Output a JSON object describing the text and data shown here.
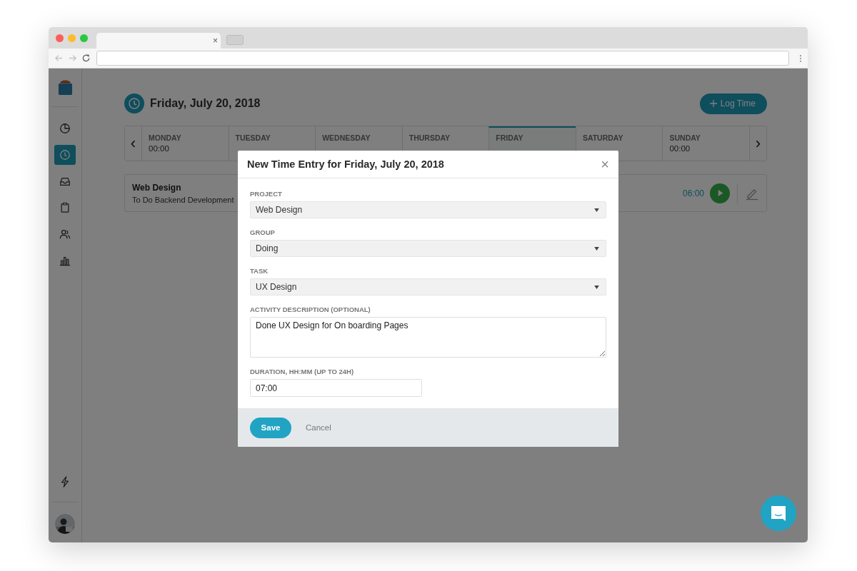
{
  "browser": {
    "tab_close": "×"
  },
  "sidebar": {
    "items": [
      {
        "kind": "pie",
        "selected": false
      },
      {
        "kind": "clock",
        "selected": true
      },
      {
        "kind": "inbox",
        "selected": false
      },
      {
        "kind": "clipboard",
        "selected": false
      },
      {
        "kind": "people",
        "selected": false
      },
      {
        "kind": "bars",
        "selected": false
      }
    ],
    "bottom": [
      {
        "kind": "bolt",
        "selected": false
      }
    ]
  },
  "header": {
    "date": "Friday, July 20, 2018",
    "log_time": "Log Time"
  },
  "week": {
    "prev": "‹",
    "next": "›",
    "days": [
      {
        "name": "MONDAY",
        "total": "00:00",
        "selected": false
      },
      {
        "name": "TUESDAY",
        "selected": false
      },
      {
        "name": "WEDNESDAY",
        "selected": false
      },
      {
        "name": "THURSDAY",
        "selected": false
      },
      {
        "name": "FRIDAY",
        "selected": true
      },
      {
        "name": "SATURDAY",
        "selected": false
      },
      {
        "name": "SUNDAY",
        "total": "00:00",
        "selected": false
      }
    ]
  },
  "entries": [
    {
      "project": "Web Design",
      "task": "To Do Backend Development",
      "time": "06:00",
      "running": false
    }
  ],
  "modal": {
    "title": "New Time Entry for Friday, July 20, 2018",
    "close": "×",
    "fields": [
      {
        "kind": "select",
        "label": "PROJECT",
        "value": "Web Design"
      },
      {
        "kind": "select",
        "label": "GROUP",
        "value": "Doing"
      },
      {
        "kind": "select",
        "label": "TASK",
        "value": "UX Design"
      },
      {
        "kind": "textarea",
        "label": "ACTIVITY DESCRIPTION (OPTIONAL)",
        "value": "Done UX Design for On boarding Pages"
      },
      {
        "kind": "input",
        "label": "DURATION, HH:MM (UP TO 24H)",
        "value": "07:00"
      }
    ],
    "save": "Save",
    "cancel": "Cancel"
  }
}
